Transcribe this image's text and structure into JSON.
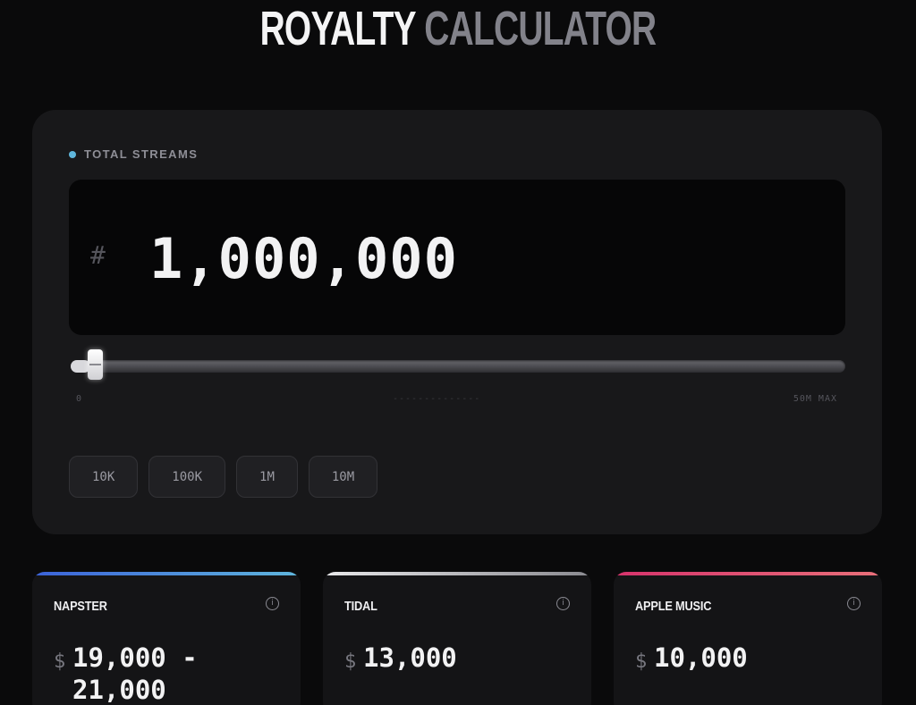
{
  "header": {
    "title_word1": "ROYALTY",
    "title_word2": "CALCULATOR"
  },
  "streams": {
    "label": "TOTAL STREAMS",
    "prefix": "#",
    "value": "1,000,000",
    "slider": {
      "min_label": "0",
      "mid_label": "--------------",
      "max_label": "50M MAX",
      "value": 1000000,
      "max": 50000000
    },
    "presets": [
      "10K",
      "100K",
      "1M",
      "10M"
    ]
  },
  "colors": {
    "accent": "#5fb6dc"
  },
  "platforms": [
    {
      "name": "NAPSTER",
      "currency": "$",
      "amount": "19,000 - 21,000",
      "bar_color": "linear-gradient(90deg,#3b62d9,#5fb6dc)",
      "icon": "info-icon"
    },
    {
      "name": "TIDAL",
      "currency": "$",
      "amount": "13,000",
      "bar_color": "linear-gradient(90deg,#e8e8ea,#8a8a90)",
      "icon": "info-icon"
    },
    {
      "name": "APPLE MUSIC",
      "currency": "$",
      "amount": "10,000",
      "bar_color": "linear-gradient(90deg,#d6336c,#e8707a)",
      "icon": "info-icon"
    }
  ]
}
